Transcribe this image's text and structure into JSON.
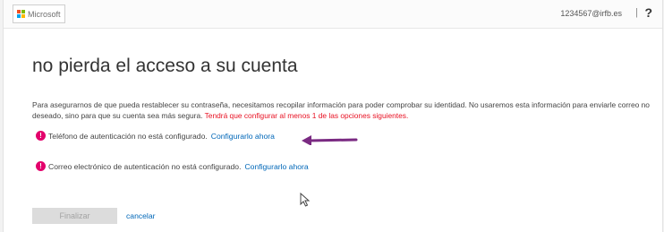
{
  "header": {
    "logo_text": "Microsoft",
    "user_email": "1234567@irfb.es",
    "separator": "|",
    "help_label": "?"
  },
  "main": {
    "title": "no pierda el acceso a su cuenta",
    "intro": "Para asegurarnos de que pueda restablecer su contraseña, necesitamos recopilar información para poder comprobar su identidad. No usaremos esta información para enviarle correo no deseado, sino para que su cuenta sea más segura.",
    "intro_warning": "Tendrá que configurar al menos 1 de las opciones siguientes.",
    "options": [
      {
        "text": "Teléfono de autenticación no está configurado.",
        "link": "Configurarlo ahora"
      },
      {
        "text": "Correo electrónico de autenticación no está configurado.",
        "link": "Configurarlo ahora"
      }
    ],
    "finish_label": "Finalizar",
    "cancel_label": "cancelar"
  },
  "colors": {
    "link": "#0067b8",
    "warning_text": "#e81123",
    "alert_icon": "#e3006b",
    "annotation_arrow": "#7a2a82"
  },
  "icons": {
    "alert": "exclamation-circle-icon",
    "annotation": "arrow-left-icon",
    "pointer": "mouse-cursor-icon"
  }
}
